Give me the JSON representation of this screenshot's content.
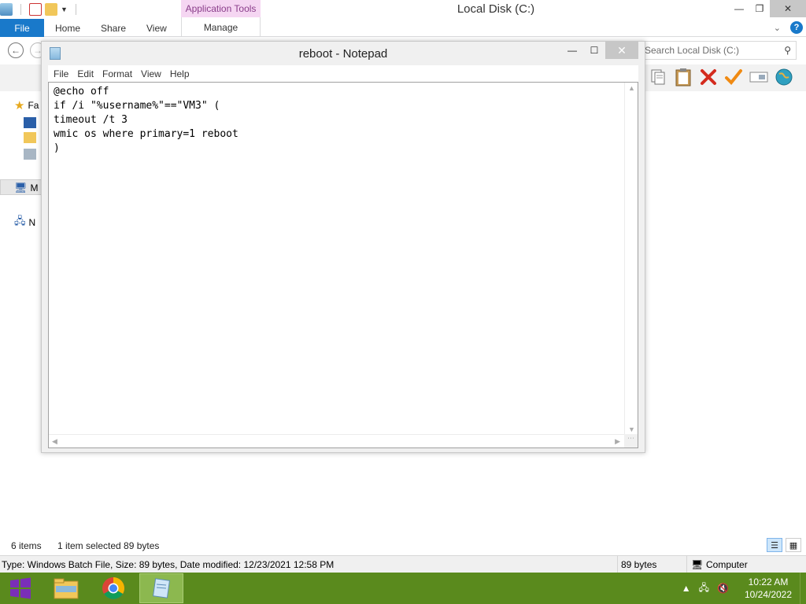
{
  "explorer": {
    "title": "Local Disk (C:)",
    "contextual_tab_group": "Application Tools",
    "tabs": {
      "file": "File",
      "home": "Home",
      "share": "Share",
      "view": "View",
      "manage": "Manage"
    },
    "search_placeholder": "Search Local Disk (C:)",
    "nav_items": [
      {
        "label": "Fa",
        "icon": "star-icon"
      },
      {
        "label": "M",
        "icon": "computer-icon"
      },
      {
        "label": "N",
        "icon": "network-icon"
      }
    ],
    "status": {
      "item_count": "6 items",
      "selection": "1 item selected  89 bytes"
    },
    "details": {
      "info": "Type: Windows Batch File, Size: 89 bytes, Date modified: 12/23/2021 12:58 PM",
      "size": "89 bytes",
      "location": "Computer"
    }
  },
  "notepad": {
    "title": "reboot - Notepad",
    "menu": [
      "File",
      "Edit",
      "Format",
      "View",
      "Help"
    ],
    "content": "@echo off\nif /i \"%username%\"==\"VM3\" (\ntimeout /t 3\nwmic os where primary=1 reboot\n)"
  },
  "taskbar": {
    "clock_time": "10:22 AM",
    "clock_date": "10/24/2022"
  }
}
